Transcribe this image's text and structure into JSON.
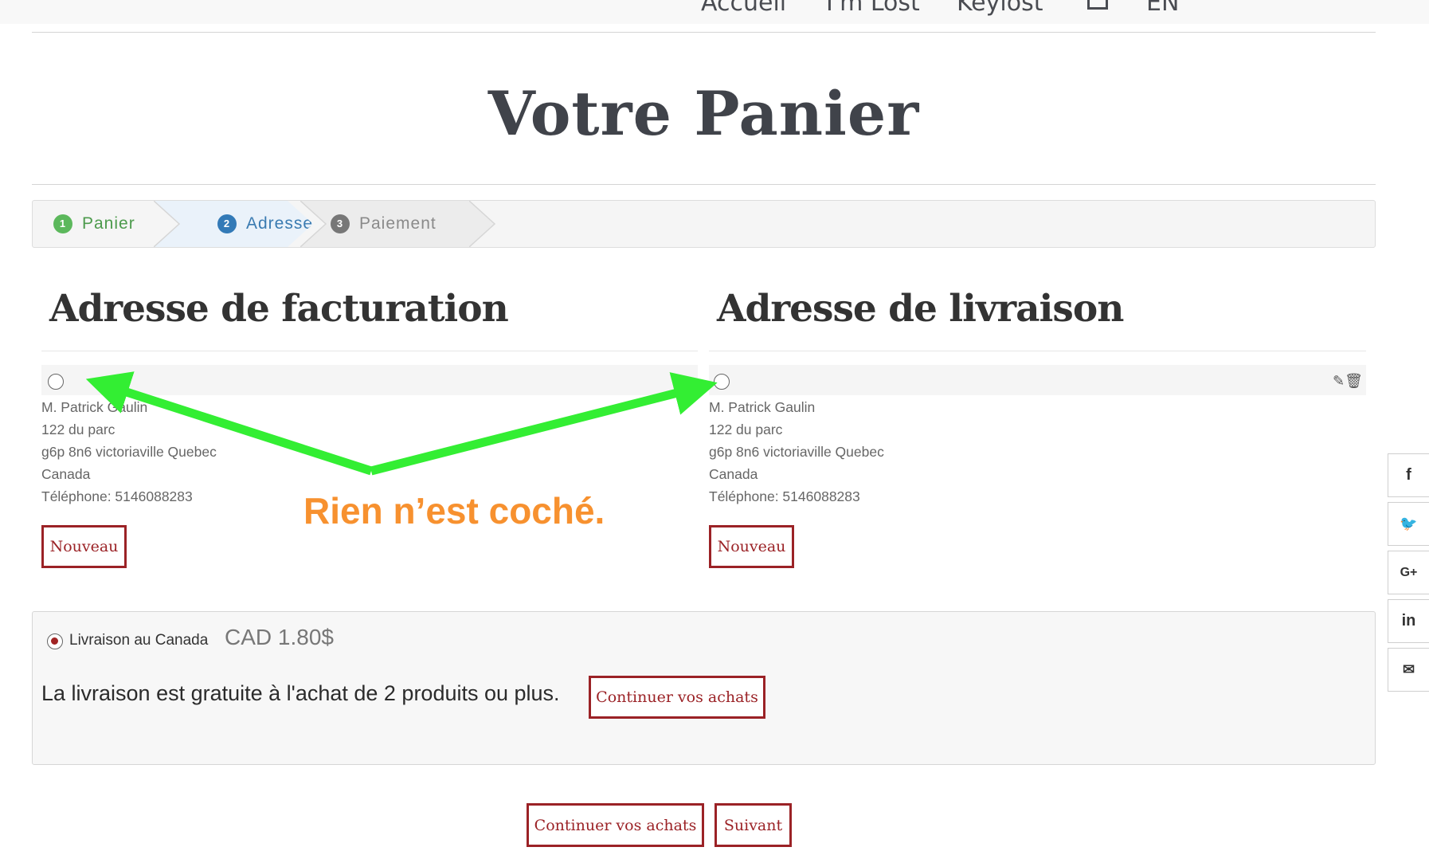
{
  "nav": {
    "items": [
      "Accueil",
      "I'm Lost",
      "Keylost",
      "EN"
    ],
    "cart_icon": "shopping-bag-icon"
  },
  "page_title": "Votre Panier",
  "steps": [
    {
      "num": "1",
      "label": "Panier",
      "state": "done"
    },
    {
      "num": "2",
      "label": "Adresse",
      "state": "active"
    },
    {
      "num": "3",
      "label": "Paiement",
      "state": "upcoming"
    }
  ],
  "billing": {
    "heading": "Adresse de facturation",
    "selected": false,
    "lines": [
      "M. Patrick Gaulin",
      "122 du parc",
      "g6p 8n6 victoriaville Quebec",
      "Canada",
      "Téléphone: 5146088283"
    ],
    "new_label": "Nouveau"
  },
  "shipping": {
    "heading": "Adresse de livraison",
    "selected": false,
    "lines": [
      "M. Patrick Gaulin",
      "122 du parc",
      "g6p 8n6 victoriaville Quebec",
      "Canada",
      "Téléphone: 5146088283"
    ],
    "new_label": "Nouveau",
    "edit_icon": "pencil-icon",
    "delete_icon": "trash-icon"
  },
  "delivery": {
    "option_label": "Livraison au Canada",
    "option_selected": true,
    "price": "CAD 1.80$",
    "note": "La livraison est gratuite à l'achat de 2 produits ou plus.",
    "continue_label": "Continuer vos achats"
  },
  "footer_actions": {
    "continue_label": "Continuer vos achats",
    "next_label": "Suivant"
  },
  "social": [
    {
      "icon": "facebook-icon",
      "glyph": "f"
    },
    {
      "icon": "twitter-icon",
      "glyph": "🐦"
    },
    {
      "icon": "google-plus-icon",
      "glyph": "G+"
    },
    {
      "icon": "linkedin-icon",
      "glyph": "in"
    },
    {
      "icon": "email-icon",
      "glyph": "✉"
    }
  ],
  "annotation": {
    "text": "Rien n’est coché.",
    "arrow_color": "#33ee33",
    "text_color": "#f7912f"
  },
  "colors": {
    "brand_red": "#9b2226",
    "step_done": "#5cb85c",
    "step_active": "#337ab7"
  }
}
